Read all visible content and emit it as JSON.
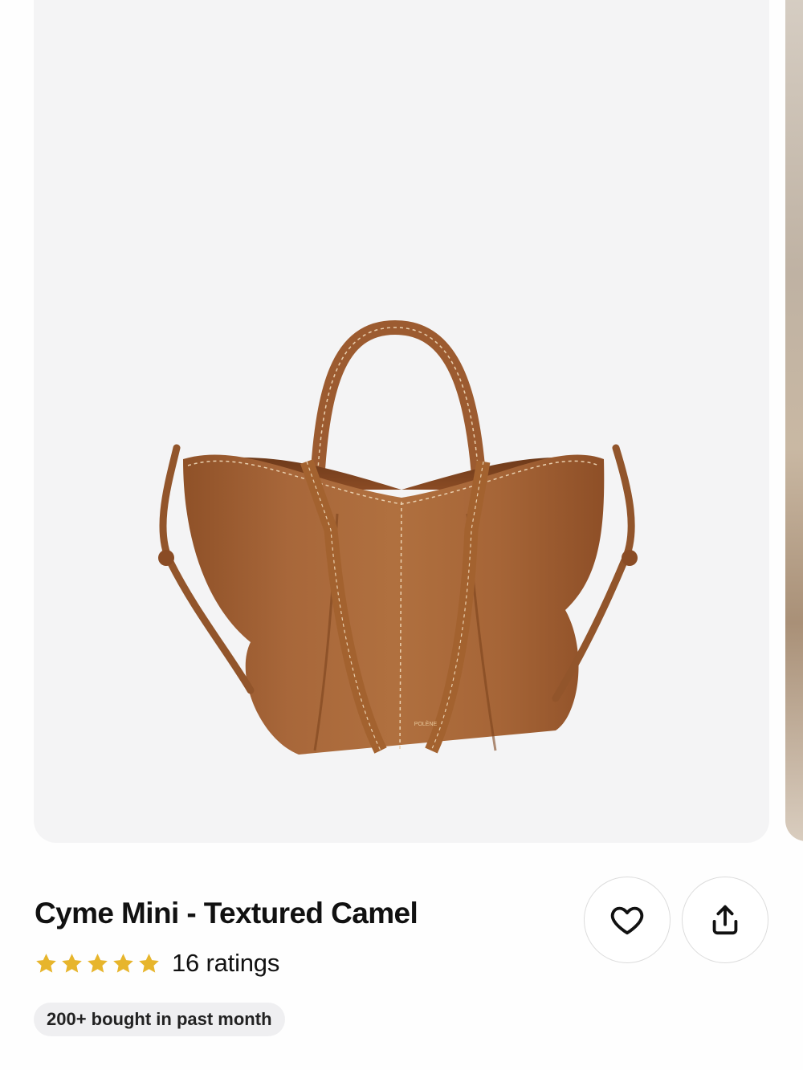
{
  "product": {
    "title": "Cyme Mini - Textured Camel",
    "rating_stars": 5,
    "ratings_text": "16 ratings",
    "badge": "200+ bought in past month",
    "brand_mark": "POLÈNE"
  },
  "actions": {
    "favorite_icon": "heart-icon",
    "share_icon": "share-icon"
  },
  "colors": {
    "star": "#e7b52c",
    "leather": "#a8673a",
    "background": "#f4f4f5"
  }
}
